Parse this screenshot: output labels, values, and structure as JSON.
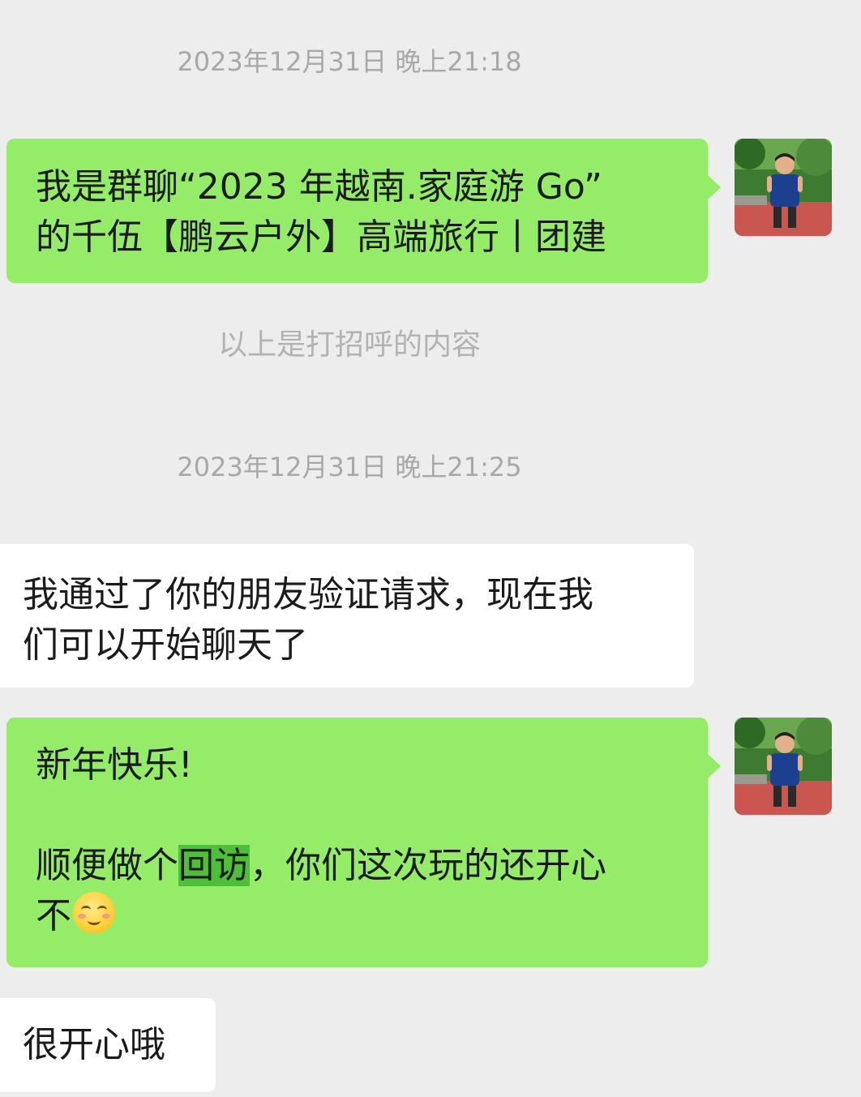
{
  "chat": {
    "timestamp_1": "2023年12月31日 晚上21:18",
    "msg_1_line_1": "我是群聊“2023 年越南.家庭游 Go”",
    "msg_1_line_2": "的千伍【鹏云户外】高端旅行丨团建",
    "system_note": "以上是打招呼的内容",
    "timestamp_2": "2023年12月31日 晚上21:25",
    "msg_2_line_1": "我通过了你的朋友验证请求，现在我",
    "msg_2_line_2": "们可以开始聊天了",
    "msg_3_line_1": "新年快乐!",
    "msg_3_line_2_pre": "顺便做个",
    "msg_3_line_2_highlight": "回访",
    "msg_3_line_2_post": "，你们这次玩的还开心",
    "msg_3_line_3": "不",
    "msg_3_emoji": "smile-emoji",
    "msg_4": "很开心哦"
  },
  "colors": {
    "background": "#ededed",
    "sent_bubble": "#95ec69",
    "received_bubble": "#ffffff",
    "highlight": "#4fbf3a",
    "timestamp_text": "#a8a8a8"
  },
  "icons": {
    "avatar": "user-avatar-photo"
  }
}
